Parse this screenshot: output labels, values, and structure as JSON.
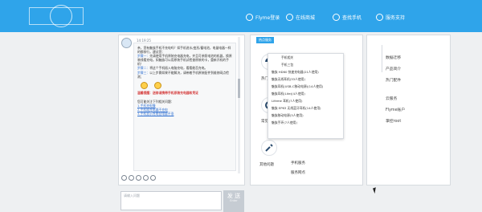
{
  "nav": [
    {
      "label": "Flyme登录",
      "icon": "user-icon"
    },
    {
      "label": "在线商城",
      "icon": "store-icon"
    },
    {
      "label": "查找手机",
      "icon": "phone-search-icon"
    },
    {
      "label": "服务支持",
      "icon": "support-icon"
    }
  ],
  "chat": {
    "time": "14:19:25",
    "greeting": "亲，您有魅族手机不充电吗？如手机进水/变形/蓄电池，电量电器一样的都排行，建议您：",
    "steps": [
      {
        "label": "步骤一：",
        "text": "先请使用手机原装充电器充电，并且可参照电池的机器，换原装线看充电。如魅族可以用原装手机试检查原装的卡，重新开机的手机！"
      },
      {
        "label": "步骤二：",
        "text": "将这个手机插入电脑充电，看看能否充电。"
      },
      {
        "label": "步骤三：",
        "text": "以上步骤如果不能解决，请带着手机原装配件到维修网点检测；"
      }
    ],
    "notice": "温馨提醒：送修请携带手机原装充电器和凭证",
    "related_title": "您可能关注下列相关问题：",
    "links": [
      "1.手机充电慢",
      "2.手机插充电器不充电",
      "3.手机显示充电但电量不涨"
    ]
  },
  "input": {
    "placeholder": "请输入问题"
  },
  "send": {
    "label": "发 送",
    "sub": "Enter"
  },
  "hot": {
    "header": "热点服务",
    "categories": [
      "热门问题",
      "常见问题",
      "其他问题"
    ]
  },
  "dropdown": {
    "items": [
      {
        "left": "手机相关",
        "right": ""
      },
      {
        "left": "手机三包",
        "right": ""
      },
      {
        "left": "魅族 HD60 快速充电器(21人使用)",
        "right": ""
      },
      {
        "left": "魅族无线耳机(33人使用)",
        "right": ""
      },
      {
        "left": "魅族耳机(USB-C移动电源)(14人使用)",
        "right": ""
      },
      {
        "left": "魅族耳机(Lite)(4人使用)",
        "right": ""
      },
      {
        "left": "Lifeme 耳机(7人使用)",
        "right": ""
      },
      {
        "left": "魅族 EP63 无线蓝牙耳机(14人使用)",
        "right": ""
      },
      {
        "left": "魅族移动电源(3人使用)",
        "right": ""
      },
      {
        "left": "魅族手环(7人使用)",
        "right": ""
      }
    ],
    "below_items": [
      "手机服务",
      "服务网点"
    ]
  },
  "side": {
    "items": [
      "数据迁移",
      "产品简介",
      "热门配件",
      "云服务",
      "Flyme账户",
      "掌控root"
    ]
  },
  "colors": {
    "primary": "#2fa4ea",
    "panel_border": "#d7dbe0",
    "send_bg": "#c6ccd3"
  }
}
